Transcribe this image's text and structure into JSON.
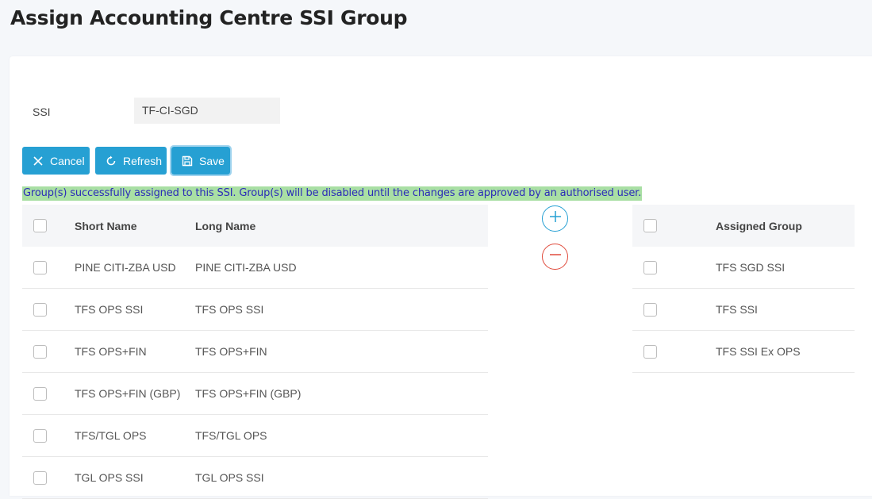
{
  "page": {
    "title": "Assign Accounting Centre SSI Group"
  },
  "form": {
    "ssi_label": "SSI",
    "ssi_value": "TF-CI-SGD"
  },
  "toolbar": {
    "cancel_label": "Cancel",
    "refresh_label": "Refresh",
    "save_label": "Save"
  },
  "alert": {
    "message": "Group(s) successfully assigned to this SSI. Group(s) will be disabled until the changes are approved by an authorised user."
  },
  "available_table": {
    "headers": {
      "short_name": "Short Name",
      "long_name": "Long Name"
    },
    "rows": [
      {
        "short_name": "PINE CITI-ZBA USD",
        "long_name": "PINE CITI-ZBA USD"
      },
      {
        "short_name": "TFS OPS SSI",
        "long_name": "TFS OPS SSI"
      },
      {
        "short_name": "TFS OPS+FIN",
        "long_name": "TFS OPS+FIN"
      },
      {
        "short_name": "TFS OPS+FIN (GBP)",
        "long_name": "TFS OPS+FIN (GBP)"
      },
      {
        "short_name": "TFS/TGL OPS",
        "long_name": "TFS/TGL OPS"
      },
      {
        "short_name": "TGL OPS SSI",
        "long_name": "TGL OPS SSI"
      }
    ]
  },
  "assigned_table": {
    "headers": {
      "assigned_group": "Assigned Group"
    },
    "rows": [
      {
        "assigned_group": "TFS SGD SSI"
      },
      {
        "assigned_group": "TFS SSI"
      },
      {
        "assigned_group": "TFS SSI Ex OPS"
      }
    ]
  },
  "icons": {
    "cancel": "close-icon",
    "refresh": "refresh-icon",
    "save": "save-icon",
    "add": "plus-circle-icon",
    "remove": "minus-circle-icon"
  },
  "colors": {
    "primary": "#26a0d3",
    "danger": "#e04b3c",
    "alert_bg": "#a9dfa4",
    "alert_text": "#2b2bb8"
  }
}
